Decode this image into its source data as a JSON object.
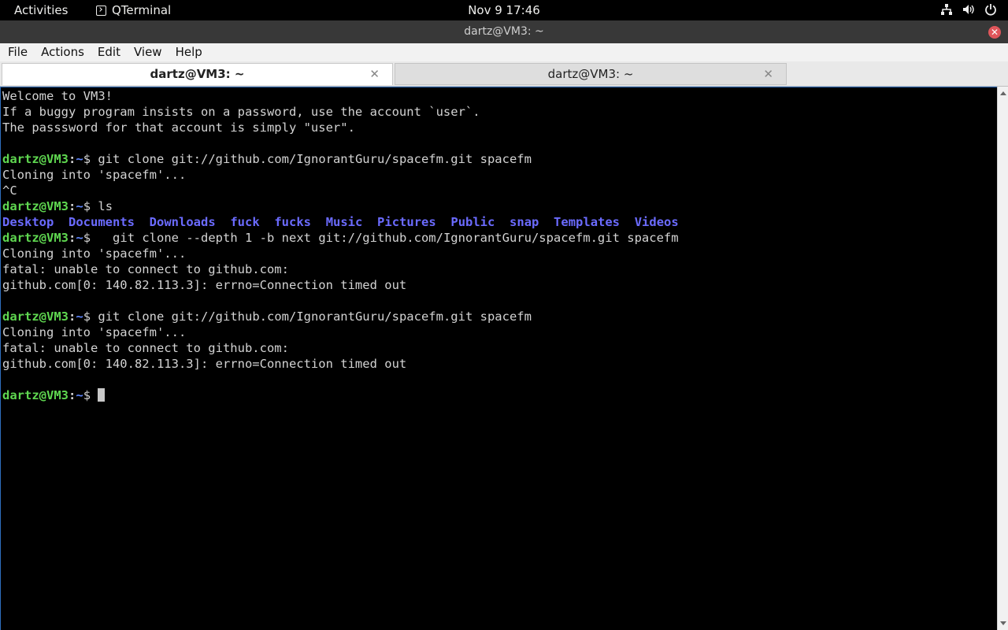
{
  "topbar": {
    "activities": "Activities",
    "app_name": "QTerminal",
    "clock": "Nov 9  17:46",
    "icons": [
      "network-icon",
      "volume-icon",
      "power-icon"
    ]
  },
  "window": {
    "title": "dartz@VM3: ~"
  },
  "menu": [
    "File",
    "Actions",
    "Edit",
    "View",
    "Help"
  ],
  "tabs": [
    {
      "label": "dartz@VM3: ~",
      "active": true
    },
    {
      "label": "dartz@VM3: ~",
      "active": false
    }
  ],
  "prompt": {
    "user_host": "dartz@VM3",
    "colon": ":",
    "path": "~",
    "dollar": "$"
  },
  "terminal": {
    "welcome": [
      "Welcome to VM3!",
      "If a buggy program insists on a password, use the account `user`.",
      "The passsword for that account is simply \"user\"."
    ],
    "cmd1": " git clone git://github.com/IgnorantGuru/spacefm.git spacefm",
    "cmd1_output": [
      "Cloning into 'spacefm'...",
      "^C"
    ],
    "cmd2": " ls",
    "ls_entries": [
      "Desktop",
      "Documents",
      "Downloads",
      "fuck",
      "fucks",
      "Music",
      "Pictures",
      "Public",
      "snap",
      "Templates",
      "Videos"
    ],
    "cmd3": "   git clone --depth 1 -b next git://github.com/IgnorantGuru/spacefm.git spacefm",
    "cmd3_output": [
      "Cloning into 'spacefm'...",
      "fatal: unable to connect to github.com:",
      "github.com[0: 140.82.113.3]: errno=Connection timed out"
    ],
    "cmd4": " git clone git://github.com/IgnorantGuru/spacefm.git spacefm",
    "cmd4_output": [
      "Cloning into 'spacefm'...",
      "fatal: unable to connect to github.com:",
      "github.com[0: 140.82.113.3]: errno=Connection timed out"
    ],
    "final_input": " "
  },
  "colors": {
    "prompt_user": "#5fd750",
    "prompt_path": "#5f87ff",
    "directory": "#6b6bff",
    "terminal_bg": "#000000",
    "terminal_fg": "#d3d3d3"
  }
}
